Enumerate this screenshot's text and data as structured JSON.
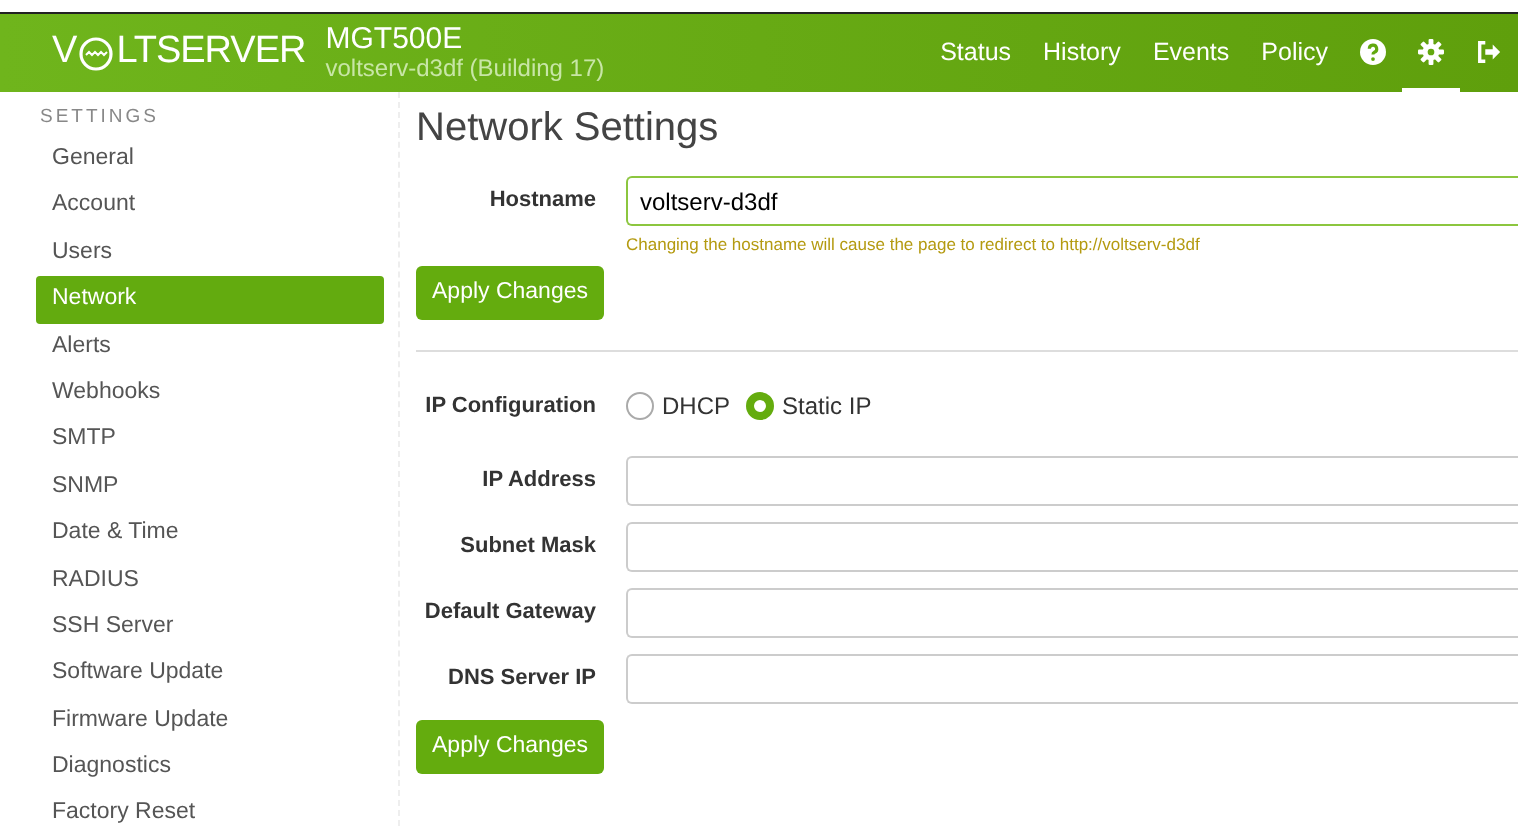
{
  "header": {
    "logo_before": "V",
    "logo_after": "LTSERVER",
    "device": "MGT500E",
    "subtitle": "voltserv-d3df (Building 17)",
    "nav": [
      {
        "label": "Status",
        "selected": false
      },
      {
        "label": "History",
        "selected": false
      },
      {
        "label": "Events",
        "selected": false
      },
      {
        "label": "Policy",
        "selected": false
      }
    ],
    "icons": [
      {
        "kind": "help",
        "selected": false
      },
      {
        "kind": "settings",
        "selected": true
      },
      {
        "kind": "logout",
        "selected": false
      }
    ]
  },
  "sidebar": {
    "heading": "SETTINGS",
    "items": [
      {
        "label": "General",
        "selected": false
      },
      {
        "label": "Account",
        "selected": false
      },
      {
        "label": "Users",
        "selected": false
      },
      {
        "label": "Network",
        "selected": true
      },
      {
        "label": "Alerts",
        "selected": false
      },
      {
        "label": "Webhooks",
        "selected": false
      },
      {
        "label": "SMTP",
        "selected": false
      },
      {
        "label": "SNMP",
        "selected": false
      },
      {
        "label": "Date & Time",
        "selected": false
      },
      {
        "label": "RADIUS",
        "selected": false
      },
      {
        "label": "SSH Server",
        "selected": false
      },
      {
        "label": "Software Update",
        "selected": false
      },
      {
        "label": "Firmware Update",
        "selected": false
      },
      {
        "label": "Diagnostics",
        "selected": false
      },
      {
        "label": "Factory Reset",
        "selected": false
      }
    ]
  },
  "title": "Network Settings",
  "hostname": {
    "label": "Hostname",
    "value": "voltserv-d3df",
    "hint": "Changing the hostname will cause the page to redirect to http://voltserv-d3df",
    "button": "Apply Changes"
  },
  "ip": {
    "label": "IP Configuration",
    "options": [
      {
        "label": "DHCP",
        "selected": false
      },
      {
        "label": "Static IP",
        "selected": true
      }
    ],
    "fields": [
      {
        "label": "IP Address"
      },
      {
        "label": "Subnet Mask"
      },
      {
        "label": "Default Gateway"
      },
      {
        "label": "DNS Server IP"
      }
    ],
    "button": "Apply Changes"
  }
}
